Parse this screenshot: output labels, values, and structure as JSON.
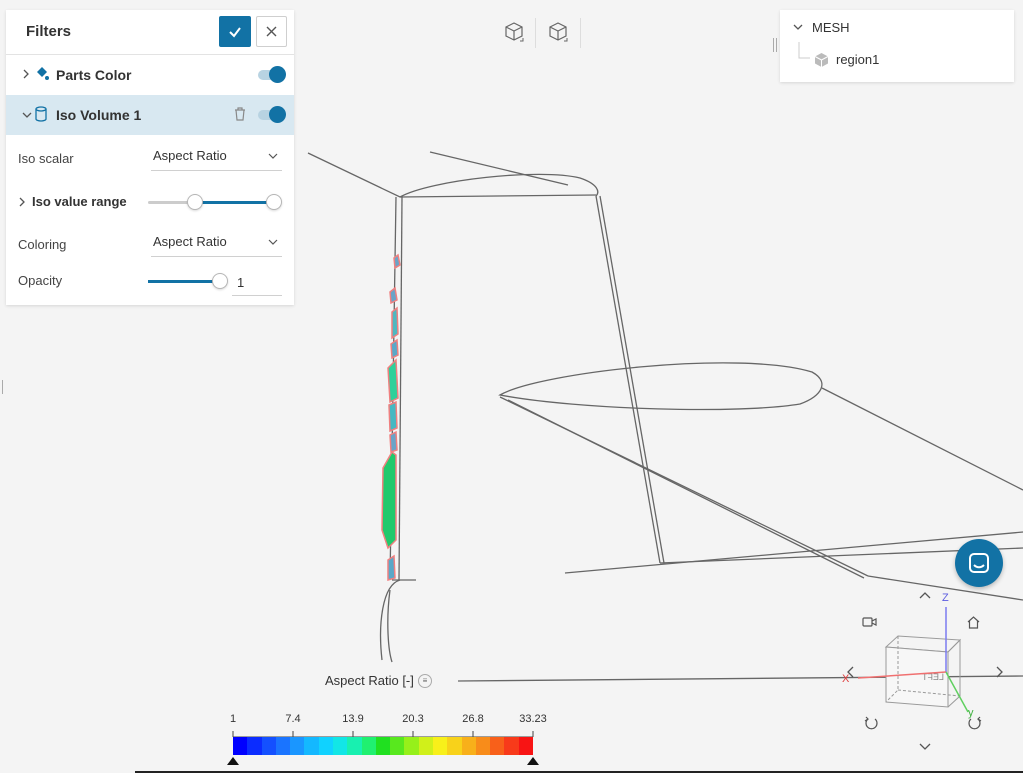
{
  "filters": {
    "title": "Filters",
    "parts_color": {
      "label": "Parts Color",
      "enabled": true
    },
    "iso_volume": {
      "label": "Iso Volume 1",
      "enabled": true,
      "iso_scalar": {
        "label": "Iso scalar",
        "value": "Aspect Ratio"
      },
      "iso_value_range": {
        "label": "Iso value range",
        "low_fraction": 0.37,
        "high_fraction": 1.0
      },
      "coloring": {
        "label": "Coloring",
        "value": "Aspect Ratio"
      },
      "opacity": {
        "label": "Opacity",
        "value": "1",
        "fraction": 1.0
      }
    }
  },
  "mesh_tree": {
    "title": "MESH",
    "items": [
      {
        "label": "region1"
      }
    ]
  },
  "legend": {
    "title": "Aspect Ratio [-]",
    "ticks": [
      "1",
      "7.4",
      "13.9",
      "20.3",
      "26.8",
      "33.23"
    ],
    "colors": [
      "#0000ff",
      "#0b2cff",
      "#1450ff",
      "#1a74ff",
      "#1a96ff",
      "#14b8ff",
      "#10d2ff",
      "#12e6e6",
      "#18f0b0",
      "#20f070",
      "#20e020",
      "#58e81e",
      "#96f01a",
      "#d0f01a",
      "#f8f01a",
      "#f8d21a",
      "#f8b01a",
      "#f88c1a",
      "#f8601a",
      "#f83a1a",
      "#f81414"
    ]
  },
  "nav_cube": {
    "face_label": "LEFT",
    "axis_x": "X",
    "axis_y": "y",
    "axis_z": "Z"
  },
  "colors": {
    "accent": "#1272a5",
    "selected_row": "#d8e8f1",
    "iso_outline": "#f08080"
  }
}
